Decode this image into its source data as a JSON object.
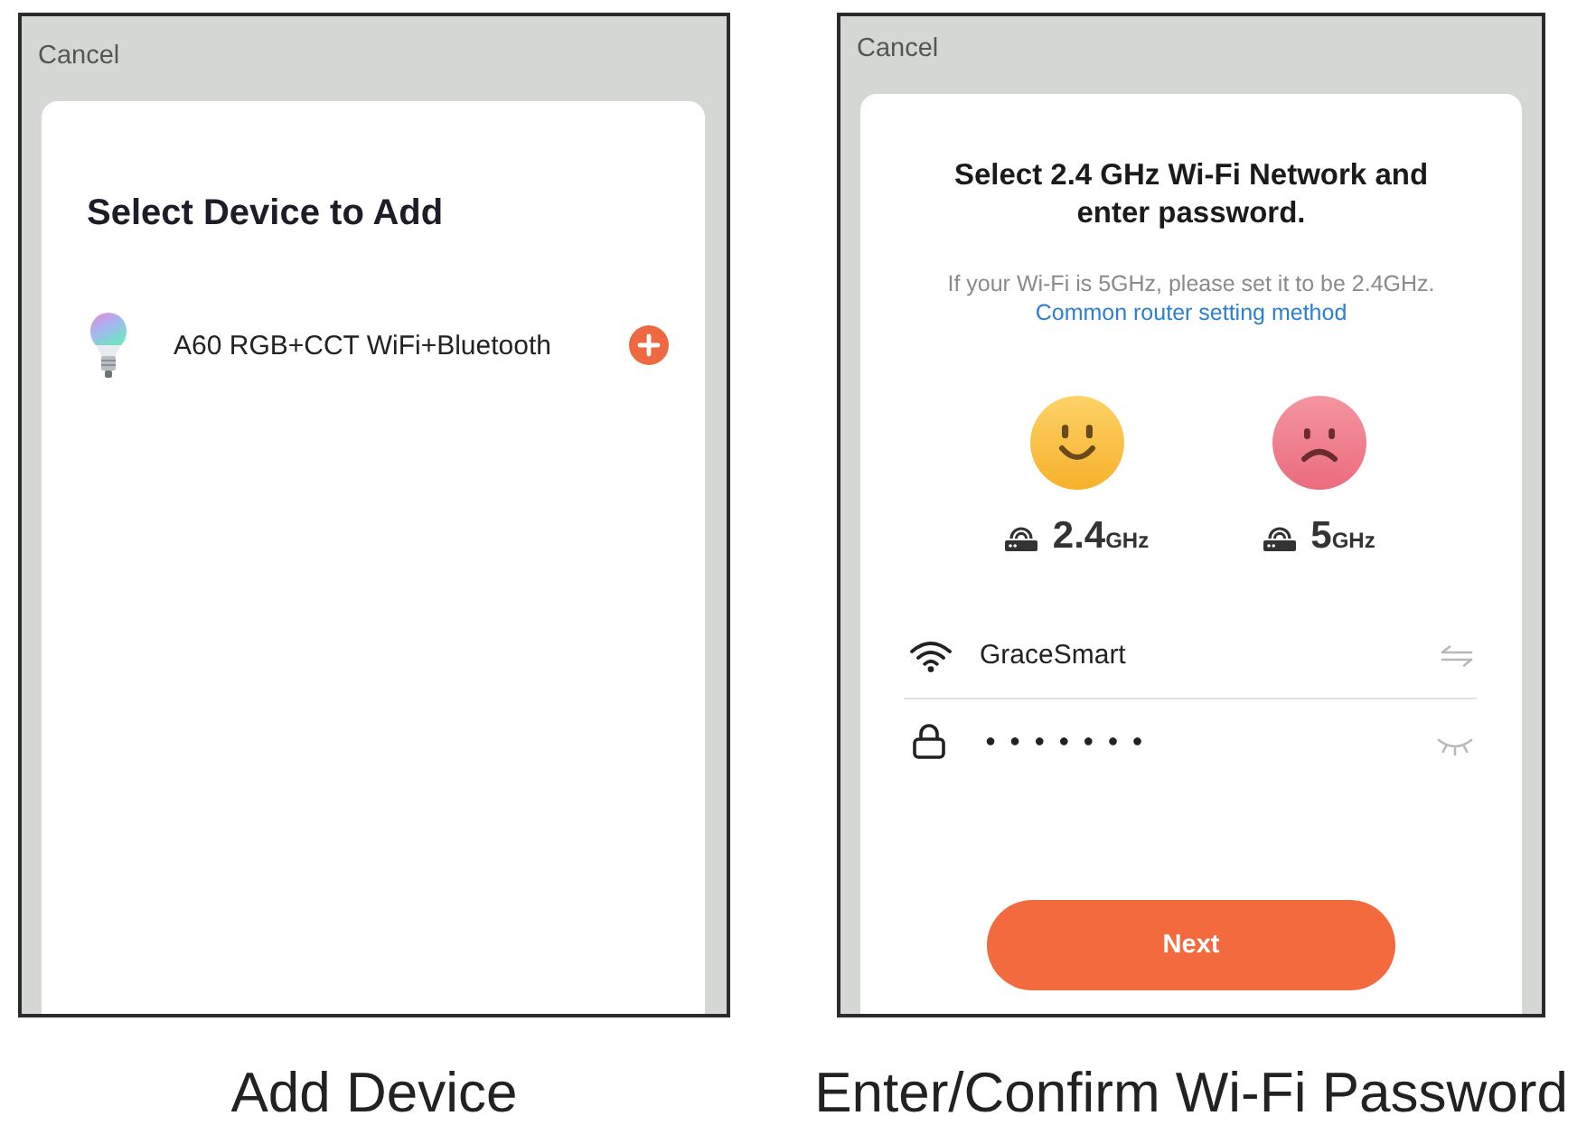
{
  "add_device": {
    "cancel": "Cancel",
    "title": "Select Device to Add",
    "devices": [
      {
        "name": "A60 RGB+CCT WiFi+Bluetooth"
      }
    ],
    "caption": "Add Device"
  },
  "wifi_password": {
    "cancel": "Cancel",
    "title": "Select 2.4 GHz Wi-Fi Network and enter password.",
    "hint": "If your Wi-Fi is 5GHz, please set it to be 2.4GHz.",
    "link": "Common router setting method",
    "bands": [
      {
        "kind": "supported",
        "value": "2.4",
        "unit": "GHz"
      },
      {
        "kind": "unsupported",
        "value": "5",
        "unit": "GHz"
      }
    ],
    "fields": [
      {
        "kind": "network",
        "value": "GraceSmart"
      },
      {
        "kind": "password",
        "value": "●●●●●●●"
      }
    ],
    "button": "Next",
    "caption": "Enter/Confirm Wi-Fi Password"
  }
}
